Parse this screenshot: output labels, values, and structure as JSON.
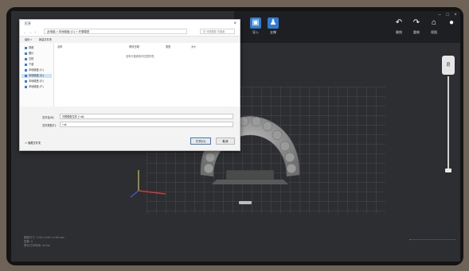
{
  "dialog": {
    "title": "打开",
    "nav_path": "此电脑 > 本地磁盘 (C:) > 牙颌模型",
    "search_placeholder": "在 牙颌模型 中搜索",
    "cmd_organize": "组织 ▾",
    "cmd_new_folder": "新建文件夹",
    "sidebar": [
      {
        "label": "视频",
        "selected": false
      },
      {
        "label": "图片",
        "selected": false
      },
      {
        "label": "文档",
        "selected": false
      },
      {
        "label": "下载",
        "selected": false
      },
      {
        "label": "本地磁盘 (C:)",
        "selected": false
      },
      {
        "label": "本地磁盘 (D:)",
        "selected": true
      },
      {
        "label": "本地磁盘 (E:)",
        "selected": false
      },
      {
        "label": "本地磁盘 (F:)",
        "selected": false
      }
    ],
    "columns": [
      "名称",
      "修改日期",
      "类型",
      "大小"
    ],
    "empty_message": "没有与搜索条件匹配的项。",
    "filename_label": "文件名(N):",
    "filename_value": "牙颌模型文件 (*.stl)",
    "filetype_label": "文件类型(T):",
    "filetype_value": "*.stl",
    "hide_folders": "∧ 隐藏文件夹",
    "open_button": "打开(O)",
    "cancel_button": "取消"
  },
  "toolbar": {
    "buttons": [
      {
        "icon": "cube-icon",
        "label": "导入"
      },
      {
        "icon": "person-icon",
        "label": "支撑"
      }
    ],
    "right_buttons": [
      {
        "icon": "undo-icon",
        "label": "撤销"
      },
      {
        "icon": "redo-icon",
        "label": "重做"
      },
      {
        "icon": "home-icon",
        "label": "视图"
      },
      {
        "icon": "user-icon",
        "label": ""
      }
    ],
    "accent_color": "#2f7bd6"
  },
  "slider": {
    "top_label": "层",
    "value_label": "100"
  },
  "info": {
    "line1": "模型尺寸: 0.00 x 0.00 x 0.00 mm",
    "line2": "层数: 0",
    "line3": "预计打印时间: 0h 0m"
  }
}
